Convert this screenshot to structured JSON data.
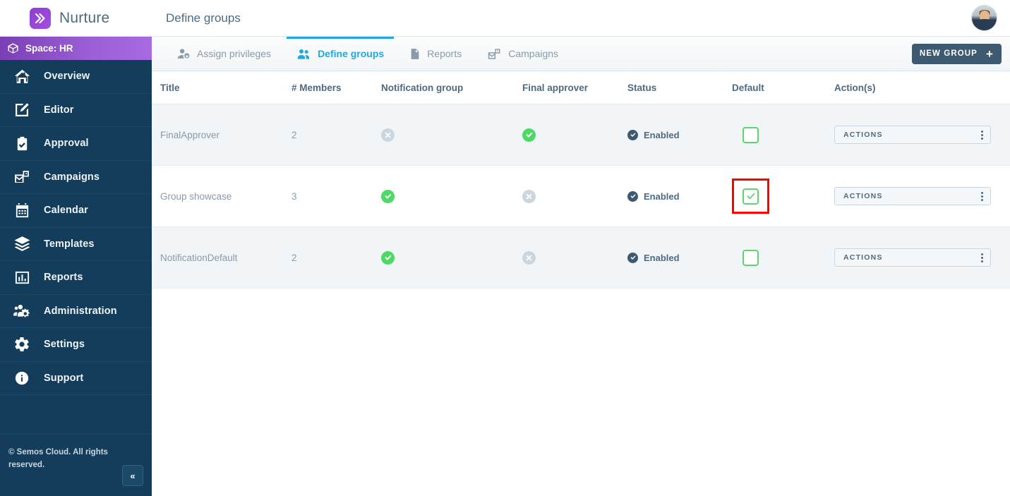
{
  "brand": {
    "name": "Nurture",
    "logo_icon": "chevrons-right-icon"
  },
  "space": {
    "label": "Space: HR",
    "icon": "cube-icon"
  },
  "sidebar": {
    "items": [
      {
        "label": "Overview",
        "icon": "home-icon"
      },
      {
        "label": "Editor",
        "icon": "pencil-square-icon"
      },
      {
        "label": "Approval",
        "icon": "clipboard-check-icon"
      },
      {
        "label": "Campaigns",
        "icon": "campaign-mail-icon"
      },
      {
        "label": "Calendar",
        "icon": "calendar-icon"
      },
      {
        "label": "Templates",
        "icon": "layers-icon"
      },
      {
        "label": "Reports",
        "icon": "bar-chart-icon"
      },
      {
        "label": "Administration",
        "icon": "users-gear-icon"
      },
      {
        "label": "Settings",
        "icon": "gear-icon"
      },
      {
        "label": "Support",
        "icon": "info-circle-icon"
      }
    ],
    "copyright": "© Semos Cloud. All rights reserved.",
    "collapse_label": "«"
  },
  "header": {
    "title": "Define groups",
    "avatar_name": "user-avatar"
  },
  "tabs": [
    {
      "label": "Assign privileges",
      "icon": "user-gear-icon",
      "active": false
    },
    {
      "label": "Define groups",
      "icon": "users-icon",
      "active": true
    },
    {
      "label": "Reports",
      "icon": "document-icon",
      "active": false
    },
    {
      "label": "Campaigns",
      "icon": "campaign-mail-icon",
      "active": false
    }
  ],
  "toolbar": {
    "new_group_label": "NEW GROUP",
    "new_group_icon": "plus-icon"
  },
  "table": {
    "columns": [
      "Title",
      "# Members",
      "Notification group",
      "Final approver",
      "Status",
      "Default",
      "Action(s)"
    ],
    "actions_label": "ACTIONS",
    "rows": [
      {
        "title": "FinalApprover",
        "members": "2",
        "notification_group": false,
        "final_approver": true,
        "status": "Enabled",
        "default": false,
        "highlighted": false,
        "shaded": true
      },
      {
        "title": "Group showcase",
        "members": "3",
        "notification_group": true,
        "final_approver": false,
        "status": "Enabled",
        "default": true,
        "highlighted": true,
        "shaded": false
      },
      {
        "title": "NotificationDefault",
        "members": "2",
        "notification_group": true,
        "final_approver": false,
        "status": "Enabled",
        "default": false,
        "highlighted": false,
        "shaded": true
      }
    ]
  },
  "colors": {
    "sidebar_bg": "#133d5a",
    "space_gradient_start": "#7b3fb5",
    "space_gradient_end": "#a76ae0",
    "accent_blue": "#22a7e0",
    "green": "#4cd964",
    "gray_icon": "#ccd6de",
    "button_dark": "#3d5a70",
    "highlight_red": "#ff0000",
    "text_muted": "#8a9aa8",
    "text_heading": "#4e6a80"
  }
}
